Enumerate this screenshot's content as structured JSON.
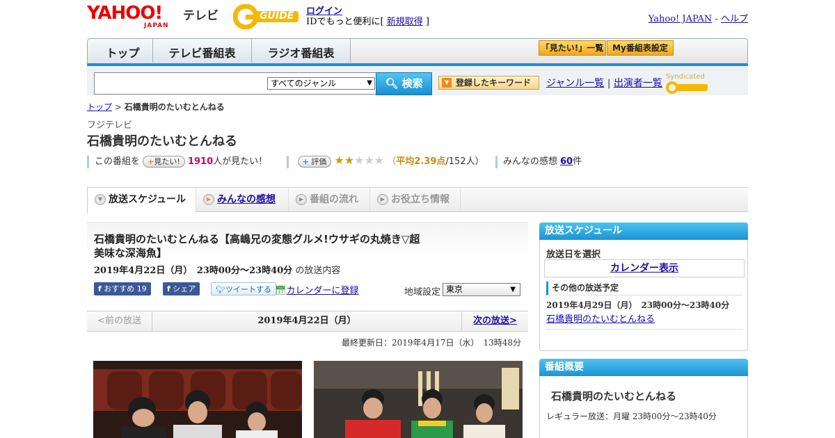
{
  "header": {
    "logo_main": "YAHOO!",
    "logo_sub": "JAPAN",
    "service": "テレビ",
    "gguide": "GUIDE",
    "login": "ログイン",
    "login_sub_prefix": "IDでもっと便利に[ ",
    "register": "新規取得",
    "login_sub_suffix": " ]",
    "yahoo_japan": "Yahoo! JAPAN",
    "separator": " - ",
    "help": "ヘルプ"
  },
  "nav": {
    "tabs": [
      "トップ",
      "テレビ番組表",
      "ラジオ番組表"
    ],
    "want_list": "「見たい!」一覧",
    "my_schedule": "My番組表設定"
  },
  "search": {
    "genre_selected": "すべてのジャンル",
    "button": "検索",
    "keyword_button": "登録したキーワード",
    "genre_list": "ジャンル一覧",
    "divider": " | ",
    "cast_list": "出演者一覧",
    "syndicated": "Syndicated"
  },
  "breadcrumb": {
    "top": "トップ",
    "sep": " > ",
    "current": "石橋貴明のたいむとんねる"
  },
  "program": {
    "channel": "フジテレビ",
    "title": "石橋貴明のたいむとんねる",
    "want_prefix": "この番組を",
    "want_pill": "見たい!",
    "want_count": "1910",
    "want_suffix": "人が見たい！",
    "rate_pill": "評価",
    "rating_stars": 2,
    "avg_label": "平均2.39点",
    "avg_count": "/152人）",
    "avg_open": "（",
    "impressions_label": "みんなの感想 ",
    "impressions_count": "60",
    "impressions_suffix": "件"
  },
  "program_tabs": [
    "放送スケジュール",
    "みんなの感想",
    "番組の流れ",
    "お役立ち情報"
  ],
  "episode": {
    "title": "石橋貴明のたいむとんねる【高嶋兄の変態グルメ!ウサギの丸焼き▽超美味な深海魚】",
    "date": "2019年4月22日（月）　23時00分～23時40分",
    "date_suffix": " の放送内容",
    "fb_recommend": "おすすめ",
    "fb_count": "19",
    "fb_share": "シェア",
    "tweet": "ツイートする",
    "calendar_register": "カレンダーに登録",
    "region_label": "地域設定",
    "region": "東京"
  },
  "pager": {
    "prev": "<前の放送",
    "current": "2019年4月22日（月）",
    "next": "次の放送>"
  },
  "updated": "最終更新日：2019年4月17日（水）　13時48分",
  "sidebar": {
    "schedule_head": "放送スケジュール",
    "select_date": "放送日を選択",
    "calendar": "カレンダー表示",
    "other_head": "その他の放送予定",
    "other_date": "2019年4月29日（月）　23時00分～23時40分",
    "other_title": "石橋貴明のたいむとんねる",
    "summary_head": "番組概要",
    "summary_title": "石橋貴明のたいむとんねる",
    "summary_regular": "レギュラー放送：月曜 23時00分～23時40分"
  },
  "colors": {
    "accent": "#1e8fd6",
    "brand_red": "#ee0000",
    "pink": "#d1006b"
  }
}
